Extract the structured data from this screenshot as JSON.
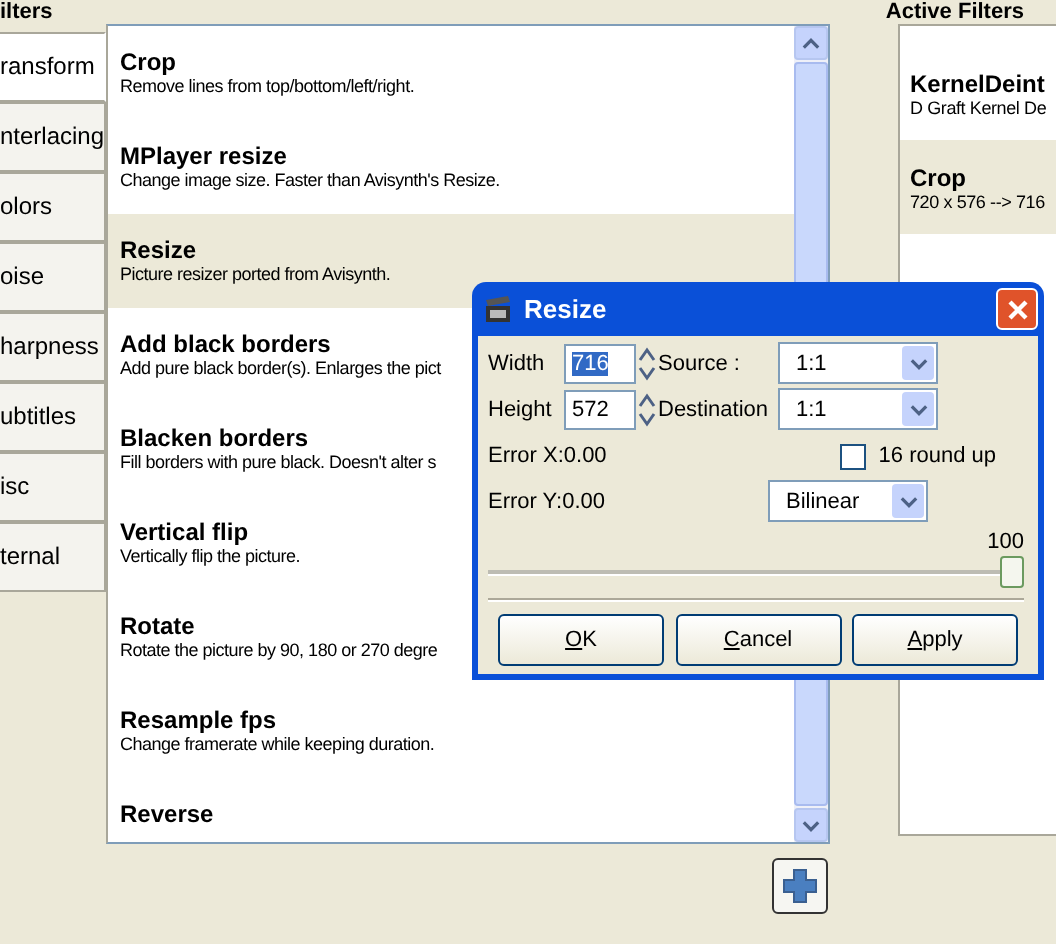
{
  "filters_heading": "ilters",
  "active_heading": "Active Filters",
  "categories": [
    {
      "label": "ransform",
      "selected": true
    },
    {
      "label": "nterlacing",
      "selected": false
    },
    {
      "label": "olors",
      "selected": false
    },
    {
      "label": "oise",
      "selected": false
    },
    {
      "label": "harpness",
      "selected": false
    },
    {
      "label": "ubtitles",
      "selected": false
    },
    {
      "label": "isc",
      "selected": false
    },
    {
      "label": "ternal",
      "selected": false
    }
  ],
  "filters": [
    {
      "name": "Crop",
      "description": "Remove lines from top/bottom/left/right.",
      "selected": false
    },
    {
      "name": "MPlayer resize",
      "description": "Change image size. Faster than Avisynth's Resize.",
      "selected": false
    },
    {
      "name": "Resize",
      "description": "Picture resizer ported from Avisynth.",
      "selected": true
    },
    {
      "name": "Add black borders",
      "description": "Add pure black border(s). Enlarges the pict",
      "selected": false
    },
    {
      "name": "Blacken borders",
      "description": "Fill borders with pure black. Doesn't alter s",
      "selected": false
    },
    {
      "name": "Vertical flip",
      "description": "Vertically flip the picture.",
      "selected": false
    },
    {
      "name": "Rotate",
      "description": "Rotate the picture by 90, 180 or 270 degre",
      "selected": false
    },
    {
      "name": "Resample fps",
      "description": "Change framerate while keeping duration.",
      "selected": false
    },
    {
      "name": "Reverse",
      "selected": false
    }
  ],
  "active_filters": [
    {
      "name": "KernelDeint",
      "description": "D Graft Kernel De",
      "selected": false
    },
    {
      "name": "Crop",
      "description": "720 x 576 --> 716",
      "selected": true
    }
  ],
  "dialog": {
    "title": "Resize",
    "width": {
      "label": "Width",
      "value": "716"
    },
    "height": {
      "label": "Height",
      "value": "572"
    },
    "source": {
      "label": "Source :",
      "value": "1:1"
    },
    "destination": {
      "label": "Destination",
      "value": "1:1"
    },
    "error_x": "Error X:0.00",
    "error_y": "Error Y:0.00",
    "round_up": {
      "label": "16 round up",
      "checked": false
    },
    "method": {
      "value": "Bilinear"
    },
    "slider": {
      "reading": "100",
      "level": 1.0
    },
    "buttons": [
      "OK",
      "Cancel",
      "Apply"
    ]
  }
}
